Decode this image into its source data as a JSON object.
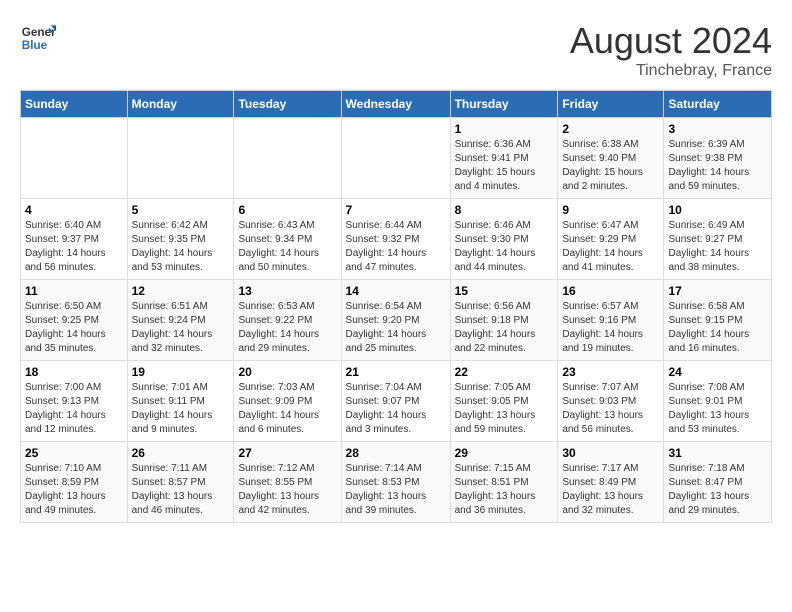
{
  "header": {
    "logo_line1": "General",
    "logo_line2": "Blue",
    "month_year": "August 2024",
    "location": "Tinchebray, France"
  },
  "days_of_week": [
    "Sunday",
    "Monday",
    "Tuesday",
    "Wednesday",
    "Thursday",
    "Friday",
    "Saturday"
  ],
  "weeks": [
    [
      {
        "day": "",
        "info": ""
      },
      {
        "day": "",
        "info": ""
      },
      {
        "day": "",
        "info": ""
      },
      {
        "day": "",
        "info": ""
      },
      {
        "day": "1",
        "info": "Sunrise: 6:36 AM\nSunset: 9:41 PM\nDaylight: 15 hours\nand 4 minutes."
      },
      {
        "day": "2",
        "info": "Sunrise: 6:38 AM\nSunset: 9:40 PM\nDaylight: 15 hours\nand 2 minutes."
      },
      {
        "day": "3",
        "info": "Sunrise: 6:39 AM\nSunset: 9:38 PM\nDaylight: 14 hours\nand 59 minutes."
      }
    ],
    [
      {
        "day": "4",
        "info": "Sunrise: 6:40 AM\nSunset: 9:37 PM\nDaylight: 14 hours\nand 56 minutes."
      },
      {
        "day": "5",
        "info": "Sunrise: 6:42 AM\nSunset: 9:35 PM\nDaylight: 14 hours\nand 53 minutes."
      },
      {
        "day": "6",
        "info": "Sunrise: 6:43 AM\nSunset: 9:34 PM\nDaylight: 14 hours\nand 50 minutes."
      },
      {
        "day": "7",
        "info": "Sunrise: 6:44 AM\nSunset: 9:32 PM\nDaylight: 14 hours\nand 47 minutes."
      },
      {
        "day": "8",
        "info": "Sunrise: 6:46 AM\nSunset: 9:30 PM\nDaylight: 14 hours\nand 44 minutes."
      },
      {
        "day": "9",
        "info": "Sunrise: 6:47 AM\nSunset: 9:29 PM\nDaylight: 14 hours\nand 41 minutes."
      },
      {
        "day": "10",
        "info": "Sunrise: 6:49 AM\nSunset: 9:27 PM\nDaylight: 14 hours\nand 38 minutes."
      }
    ],
    [
      {
        "day": "11",
        "info": "Sunrise: 6:50 AM\nSunset: 9:25 PM\nDaylight: 14 hours\nand 35 minutes."
      },
      {
        "day": "12",
        "info": "Sunrise: 6:51 AM\nSunset: 9:24 PM\nDaylight: 14 hours\nand 32 minutes."
      },
      {
        "day": "13",
        "info": "Sunrise: 6:53 AM\nSunset: 9:22 PM\nDaylight: 14 hours\nand 29 minutes."
      },
      {
        "day": "14",
        "info": "Sunrise: 6:54 AM\nSunset: 9:20 PM\nDaylight: 14 hours\nand 25 minutes."
      },
      {
        "day": "15",
        "info": "Sunrise: 6:56 AM\nSunset: 9:18 PM\nDaylight: 14 hours\nand 22 minutes."
      },
      {
        "day": "16",
        "info": "Sunrise: 6:57 AM\nSunset: 9:16 PM\nDaylight: 14 hours\nand 19 minutes."
      },
      {
        "day": "17",
        "info": "Sunrise: 6:58 AM\nSunset: 9:15 PM\nDaylight: 14 hours\nand 16 minutes."
      }
    ],
    [
      {
        "day": "18",
        "info": "Sunrise: 7:00 AM\nSunset: 9:13 PM\nDaylight: 14 hours\nand 12 minutes."
      },
      {
        "day": "19",
        "info": "Sunrise: 7:01 AM\nSunset: 9:11 PM\nDaylight: 14 hours\nand 9 minutes."
      },
      {
        "day": "20",
        "info": "Sunrise: 7:03 AM\nSunset: 9:09 PM\nDaylight: 14 hours\nand 6 minutes."
      },
      {
        "day": "21",
        "info": "Sunrise: 7:04 AM\nSunset: 9:07 PM\nDaylight: 14 hours\nand 3 minutes."
      },
      {
        "day": "22",
        "info": "Sunrise: 7:05 AM\nSunset: 9:05 PM\nDaylight: 13 hours\nand 59 minutes."
      },
      {
        "day": "23",
        "info": "Sunrise: 7:07 AM\nSunset: 9:03 PM\nDaylight: 13 hours\nand 56 minutes."
      },
      {
        "day": "24",
        "info": "Sunrise: 7:08 AM\nSunset: 9:01 PM\nDaylight: 13 hours\nand 53 minutes."
      }
    ],
    [
      {
        "day": "25",
        "info": "Sunrise: 7:10 AM\nSunset: 8:59 PM\nDaylight: 13 hours\nand 49 minutes."
      },
      {
        "day": "26",
        "info": "Sunrise: 7:11 AM\nSunset: 8:57 PM\nDaylight: 13 hours\nand 46 minutes."
      },
      {
        "day": "27",
        "info": "Sunrise: 7:12 AM\nSunset: 8:55 PM\nDaylight: 13 hours\nand 42 minutes."
      },
      {
        "day": "28",
        "info": "Sunrise: 7:14 AM\nSunset: 8:53 PM\nDaylight: 13 hours\nand 39 minutes."
      },
      {
        "day": "29",
        "info": "Sunrise: 7:15 AM\nSunset: 8:51 PM\nDaylight: 13 hours\nand 36 minutes."
      },
      {
        "day": "30",
        "info": "Sunrise: 7:17 AM\nSunset: 8:49 PM\nDaylight: 13 hours\nand 32 minutes."
      },
      {
        "day": "31",
        "info": "Sunrise: 7:18 AM\nSunset: 8:47 PM\nDaylight: 13 hours\nand 29 minutes."
      }
    ]
  ]
}
